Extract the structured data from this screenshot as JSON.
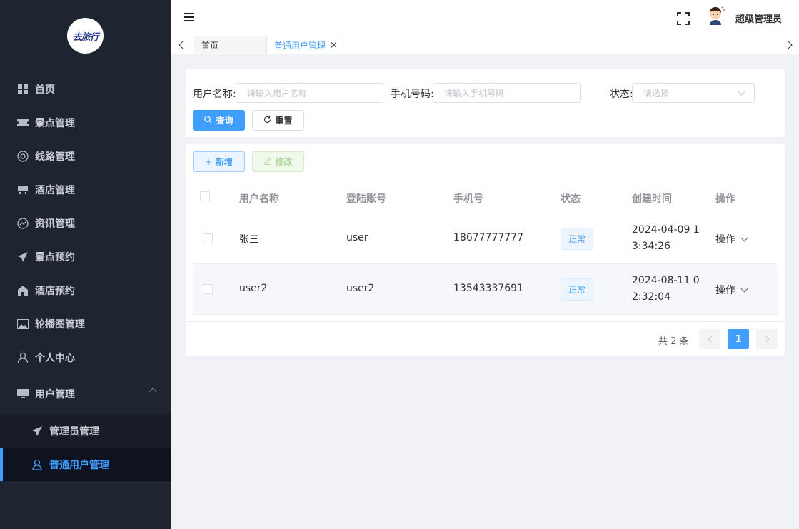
{
  "logo": {
    "text": "去旅行"
  },
  "sidebar": {
    "items": [
      {
        "label": "首页",
        "icon": "grid-icon"
      },
      {
        "label": "景点管理",
        "icon": "ticket-icon"
      },
      {
        "label": "线路管理",
        "icon": "lifebuoy-icon"
      },
      {
        "label": "酒店管理",
        "icon": "sofa-icon"
      },
      {
        "label": "资讯管理",
        "icon": "chart-circle-icon"
      },
      {
        "label": "景点预约",
        "icon": "paper-plane-icon"
      },
      {
        "label": "酒店预约",
        "icon": "home-icon"
      },
      {
        "label": "轮播图管理",
        "icon": "picture-icon"
      },
      {
        "label": "个人中心",
        "icon": "user-icon"
      }
    ],
    "user_menu": {
      "label": "用户管理",
      "icon": "monitor-icon",
      "children": [
        {
          "label": "管理员管理",
          "icon": "paper-plane-icon"
        },
        {
          "label": "普通用户管理",
          "icon": "user-icon",
          "active": true
        }
      ]
    }
  },
  "header": {
    "username": "超级管理员"
  },
  "tags": {
    "home": "首页",
    "active": "普通用户管理",
    "close": "×"
  },
  "search": {
    "username_label": "用户名称:",
    "username_placeholder": "请输入用户名称",
    "phone_label": "手机号码:",
    "phone_placeholder": "请输入手机号码",
    "status_label": "状态:",
    "status_placeholder": "请选择",
    "query_label": "查询",
    "reset_label": "重置"
  },
  "toolbar": {
    "add_label": "新增",
    "edit_label": "修改"
  },
  "table": {
    "columns": [
      "用户名称",
      "登陆账号",
      "手机号",
      "状态",
      "创建时间",
      "操作"
    ],
    "rows": [
      {
        "name": "张三",
        "account": "user",
        "phone": "18677777777",
        "status": "正常",
        "created": "2024-04-09 13:34:26",
        "action": "操作"
      },
      {
        "name": "user2",
        "account": "user2",
        "phone": "13543337691",
        "status": "正常",
        "created": "2024-08-11 02:32:04",
        "action": "操作"
      }
    ]
  },
  "pagination": {
    "total_text": "共 2 条",
    "current_page": "1"
  },
  "colors": {
    "primary": "#409eff",
    "sidebar_bg": "#1f2431"
  }
}
